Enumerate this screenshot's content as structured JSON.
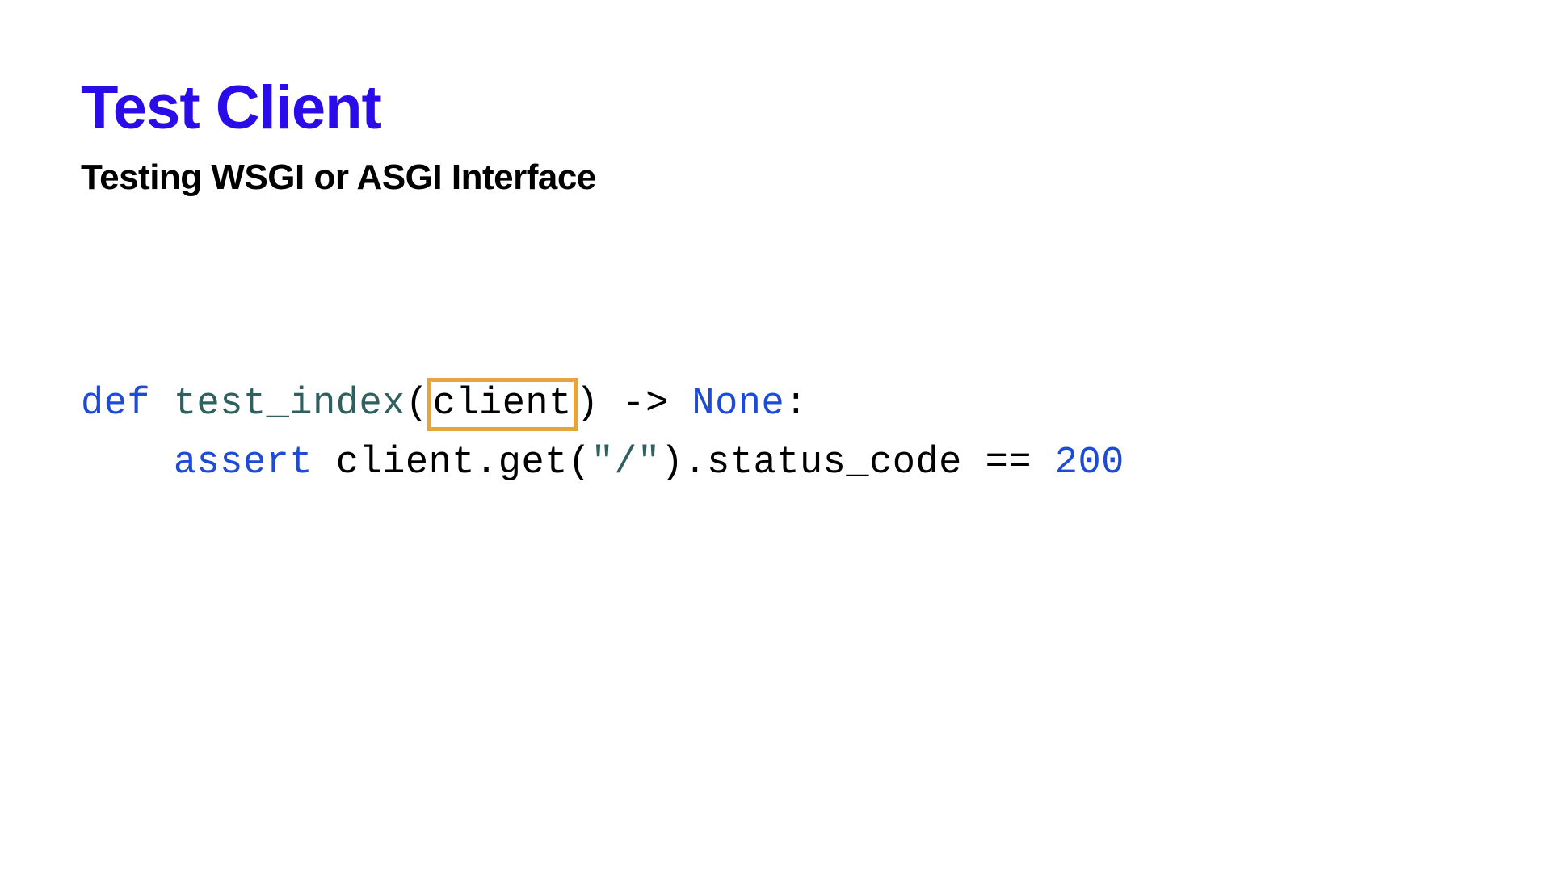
{
  "header": {
    "title": "Test Client",
    "subtitle": "Testing WSGI or ASGI Interface"
  },
  "code": {
    "line1": {
      "kw_def": "def",
      "fn_name": "test_index",
      "paren_open": "(",
      "param": "client",
      "paren_close": ")",
      "arrow": " -> ",
      "ret_type": "None",
      "colon": ":"
    },
    "line2": {
      "indent": "    ",
      "kw_assert": "assert",
      "space1": " ",
      "obj": "client",
      "dot1": ".",
      "method": "get",
      "paren_open": "(",
      "arg": "\"/\"",
      "paren_close": ")",
      "dot2": ".",
      "attr": "status_code",
      "eq": " == ",
      "num": "200"
    }
  }
}
